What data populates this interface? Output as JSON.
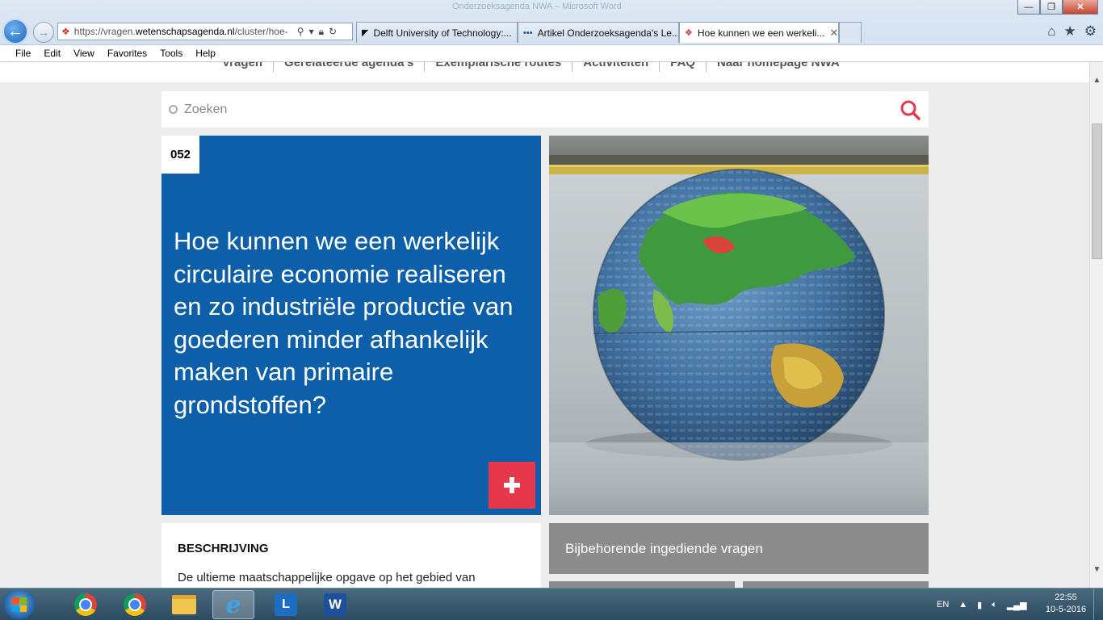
{
  "browser": {
    "window_title": "Onderzoeksagenda NWA – Microsoft Word",
    "window_buttons": {
      "minimize": "—",
      "maximize": "❐",
      "close": "✕"
    },
    "address": {
      "prefix": "https://vragen.",
      "domain": "wetenschapsagenda.nl",
      "path": "/cluster/hoe-"
    },
    "tabs": [
      {
        "title": "Delft University of Technology:...",
        "icon": "tu-delft-icon"
      },
      {
        "title": "Artikel Onderzoeksagenda's Le...",
        "icon": "dots-icon"
      },
      {
        "title": "Hoe kunnen we een werkeli...",
        "icon": "nwa-favicon-icon",
        "active": true
      }
    ],
    "tab_close": "✕",
    "menu": [
      "File",
      "Edit",
      "View",
      "Favorites",
      "Tools",
      "Help"
    ],
    "icons": {
      "home": "⌂",
      "favorites": "★",
      "tools": "⚙"
    }
  },
  "site": {
    "nav": [
      "Vragen",
      "Gerelateerde agenda's",
      "Exemplarische routes",
      "Activiteiten",
      "FAQ",
      "Naar homepage NWA"
    ],
    "search": {
      "placeholder": "Zoeken",
      "icon": "search-icon"
    },
    "question": {
      "number": "052",
      "title": "Hoe kunnen we een werkelijk circulaire economie realiseren en zo industriële productie van goederen minder afhankelijk maken van primaire grondstoffen?"
    },
    "description": {
      "heading": "BESCHRIJVING",
      "text": "De ultieme maatschappelijke opgave op het gebied van"
    },
    "related": {
      "label": "Bijbehorende ingediende vragen"
    },
    "colors": {
      "blue": "#0c5fa8",
      "red": "#e5384c",
      "gray": "#8c8c8c"
    }
  },
  "taskbar": {
    "language": "EN",
    "time": "22:55",
    "date": "10-5-2016",
    "apps": [
      "chrome-icon",
      "chrome-icon",
      "folder-icon",
      "ie-icon",
      "lync-icon",
      "word-icon"
    ],
    "lync_letter": "L",
    "word_letter": "W",
    "ie_letter": "e",
    "tray_arrow": "▲"
  }
}
